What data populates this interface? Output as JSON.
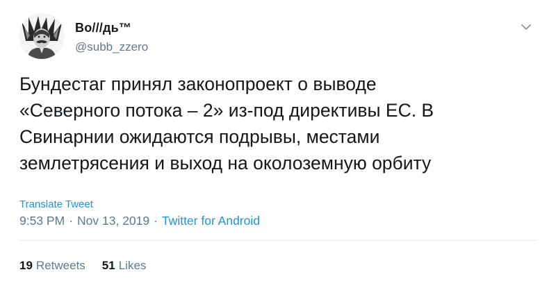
{
  "author": {
    "display_name": "Во///дь™",
    "handle": "@subb_zzero"
  },
  "tweet": {
    "text": "Бундестаг принял законопроект о выводе\n«Северного потока – 2» из-под директивы ЕС. В\nСвинарнии ожидаются подрывы, местами\nземлетрясения и выход на околоземную орбиту",
    "translate_label": "Translate Tweet",
    "time": "9:53 PM",
    "separator": "·",
    "date": "Nov 13, 2019",
    "source": "Twitter for Android"
  },
  "stats": {
    "retweets_count": "19",
    "retweets_label": "Retweets",
    "likes_count": "51",
    "likes_label": "Likes"
  },
  "icons": {
    "menu": "chevron-down-icon"
  },
  "colors": {
    "link": "#1b95e0",
    "muted": "#657786",
    "text": "#14171a",
    "divider": "#e6ecf0"
  }
}
